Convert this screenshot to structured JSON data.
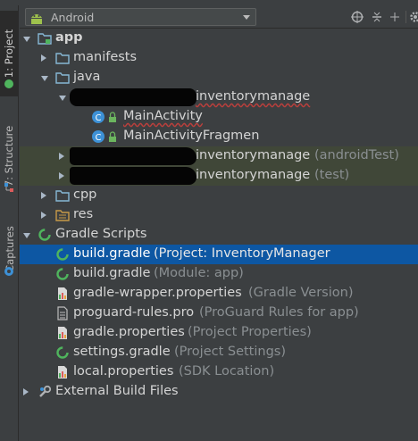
{
  "left_strip": {
    "project_tab": "1: Project",
    "structure_tab": "7: Structure",
    "captures_tab": "Captures"
  },
  "header": {
    "view_select": "Android"
  },
  "tree": {
    "app": "app",
    "manifests": "manifests",
    "java": "java",
    "package_main": "inventorymanage",
    "main_activity": "MainActivity",
    "main_activity_fragment": "MainActivityFragmen",
    "package_android_test": "inventorymanage",
    "android_test_suffix": "(androidTest)",
    "package_test": "inventorymanage",
    "test_suffix": "(test)",
    "cpp": "cpp",
    "res": "res",
    "gradle_scripts": "Gradle Scripts",
    "build_gradle_project": "build.gradle",
    "build_gradle_project_suffix": "(Project: InventoryManager",
    "build_gradle_module": "build.gradle",
    "build_gradle_module_suffix": "(Module: app)",
    "gradle_wrapper": "gradle-wrapper.properties",
    "gradle_wrapper_suffix": "(Gradle Version)",
    "proguard": "proguard-rules.pro",
    "proguard_suffix": "(ProGuard Rules for app)",
    "gradle_properties": "gradle.properties",
    "gradle_properties_suffix": "(Project Properties)",
    "settings_gradle": "settings.gradle",
    "settings_gradle_suffix": "(Project Settings)",
    "local_properties": "local.properties",
    "local_properties_suffix": "(SDK Location)",
    "external_build_files": "External Build Files"
  },
  "colors": {
    "background": "#3c3f41",
    "selection": "#0d57a3",
    "test_highlight": "#404738",
    "text": "#d4d4d4",
    "secondary_text": "#8a8f92",
    "folder_icon": "#87b8d6",
    "class_icon": "#3d91d6",
    "gradle_icon": "#4fb45d"
  }
}
